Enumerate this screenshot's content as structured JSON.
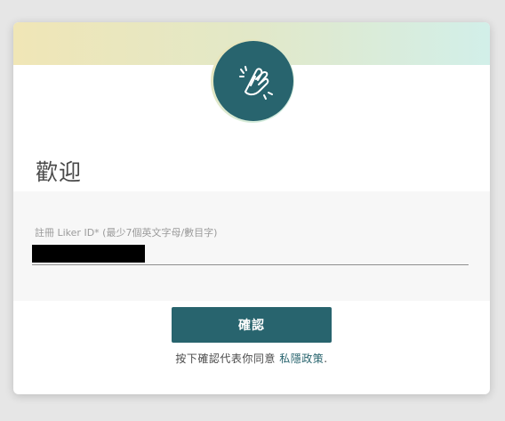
{
  "dialog": {
    "title": "歡迎",
    "icon": "clapping-hands-icon"
  },
  "form": {
    "liker_id_label": "註冊 Liker ID* (最少7個英文字母/數目字)",
    "liker_id_value": ""
  },
  "actions": {
    "confirm_label": "確認"
  },
  "legal": {
    "prefix": "按下確認代表你同意 ",
    "link": "私隱政策",
    "suffix": "."
  },
  "colors": {
    "primary": "#28646e",
    "banner_left": "#f0e6b6",
    "banner_right": "#d2efe9"
  }
}
